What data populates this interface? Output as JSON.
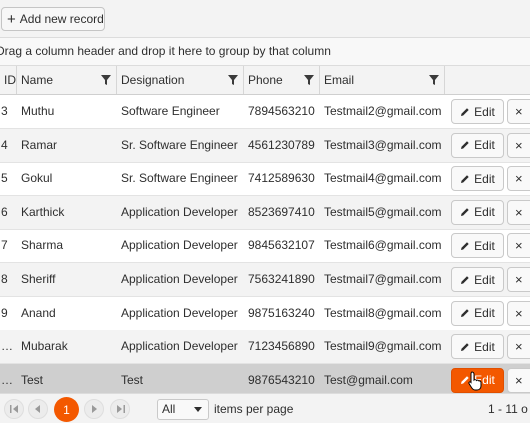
{
  "toolbar": {
    "add_label": "Add new record"
  },
  "group_hint": "Drag a column header and drop it here to group by that column",
  "columns": [
    "ID",
    "Name",
    "Designation",
    "Phone",
    "Email"
  ],
  "rows": [
    {
      "id": "3",
      "name": "Muthu",
      "designation": "Software Engineer",
      "phone": "7894563210",
      "email": "Testmail2@gmail.com"
    },
    {
      "id": "4",
      "name": "Ramar",
      "designation": "Sr. Software Engineer",
      "phone": "4561230789",
      "email": "Testmail3@gmail.com"
    },
    {
      "id": "5",
      "name": "Gokul",
      "designation": "Sr. Software Engineer",
      "phone": "7412589630",
      "email": "Testmail4@gmail.com"
    },
    {
      "id": "6",
      "name": "Karthick",
      "designation": "Application Developer",
      "phone": "8523697410",
      "email": "Testmail5@gmail.com"
    },
    {
      "id": "7",
      "name": "Sharma",
      "designation": "Application Developer",
      "phone": "9845632107",
      "email": "Testmail6@gmail.com"
    },
    {
      "id": "8",
      "name": "Sheriff",
      "designation": "Application Developer",
      "phone": "7563241890",
      "email": "Testmail7@gmail.com"
    },
    {
      "id": "9",
      "name": "Anand",
      "designation": "Application Developer",
      "phone": "9875163240",
      "email": "Testmail8@gmail.com"
    },
    {
      "id": "…",
      "name": "Mubarak",
      "designation": "Application Developer",
      "phone": "7123456890",
      "email": "Testmail9@gmail.com"
    },
    {
      "id": "…",
      "name": "Test",
      "designation": "Test",
      "phone": "9876543210",
      "email": "Test@gmail.com"
    }
  ],
  "row_actions": {
    "edit_label": "Edit",
    "delete_label": "×"
  },
  "pager": {
    "current_page": "1",
    "page_size": "All",
    "page_size_label": "items per page",
    "info": "1 - 11 o"
  },
  "colors": {
    "accent": "#f35800",
    "header_bg": "#f3f3f3",
    "selected_row": "#cfcfcf"
  },
  "icons": [
    "plus-icon",
    "filter-icon",
    "pencil-icon",
    "close-icon",
    "first-page-icon",
    "prev-page-icon",
    "next-page-icon",
    "last-page-icon",
    "caret-down-icon",
    "mouse-cursor-icon"
  ]
}
